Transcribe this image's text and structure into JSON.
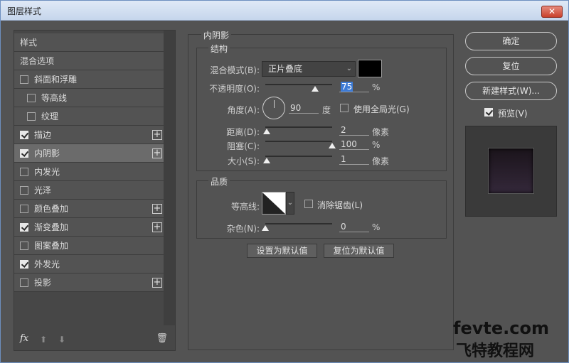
{
  "window": {
    "title": "图层样式",
    "close": "✕"
  },
  "left_panel": {
    "items": [
      {
        "label": "样式",
        "kind": "header"
      },
      {
        "label": "混合选项",
        "kind": "plain"
      },
      {
        "label": "斜面和浮雕",
        "checked": false
      },
      {
        "label": "等高线",
        "checked": false,
        "sub": true
      },
      {
        "label": "纹理",
        "checked": false,
        "sub": true
      },
      {
        "label": "描边",
        "checked": true,
        "plus": true
      },
      {
        "label": "内阴影",
        "checked": true,
        "plus": true,
        "active": true
      },
      {
        "label": "内发光",
        "checked": false
      },
      {
        "label": "光泽",
        "checked": false
      },
      {
        "label": "颜色叠加",
        "checked": false,
        "plus": true
      },
      {
        "label": "渐变叠加",
        "checked": true,
        "plus": true
      },
      {
        "label": "图案叠加",
        "checked": false
      },
      {
        "label": "外发光",
        "checked": true
      },
      {
        "label": "投影",
        "checked": false,
        "plus": true
      }
    ],
    "footer": {
      "fx": "fx",
      "up": "⬆",
      "down": "⬇",
      "trash": "🗑"
    }
  },
  "inner_shadow": {
    "title": "内阴影",
    "structure": {
      "title": "结构",
      "blend_mode_label": "混合模式(B):",
      "blend_mode_value": "正片叠底",
      "opacity_label": "不透明度(O):",
      "opacity_value": "75",
      "angle_label": "角度(A):",
      "angle_value": "90",
      "angle_unit": "度",
      "global_light_label": "使用全局光(G)",
      "distance_label": "距离(D):",
      "distance_value": "2",
      "choke_label": "阻塞(C):",
      "choke_value": "100",
      "size_label": "大小(S):",
      "size_value": "1",
      "unit_pct": "%",
      "unit_px": "像素"
    },
    "quality": {
      "title": "品质",
      "contour_label": "等高线:",
      "antialias_label": "消除锯齿(L)",
      "noise_label": "杂色(N):",
      "noise_value": "0",
      "unit_pct": "%"
    },
    "set_default": "设置为默认值",
    "reset_default": "复位为默认值"
  },
  "right_panel": {
    "ok": "确定",
    "reset": "复位",
    "new_style": "新建样式(W)...",
    "preview_label": "预览(V)"
  },
  "watermark": {
    "line1": "fevte.com",
    "line2": "飞特教程网"
  }
}
